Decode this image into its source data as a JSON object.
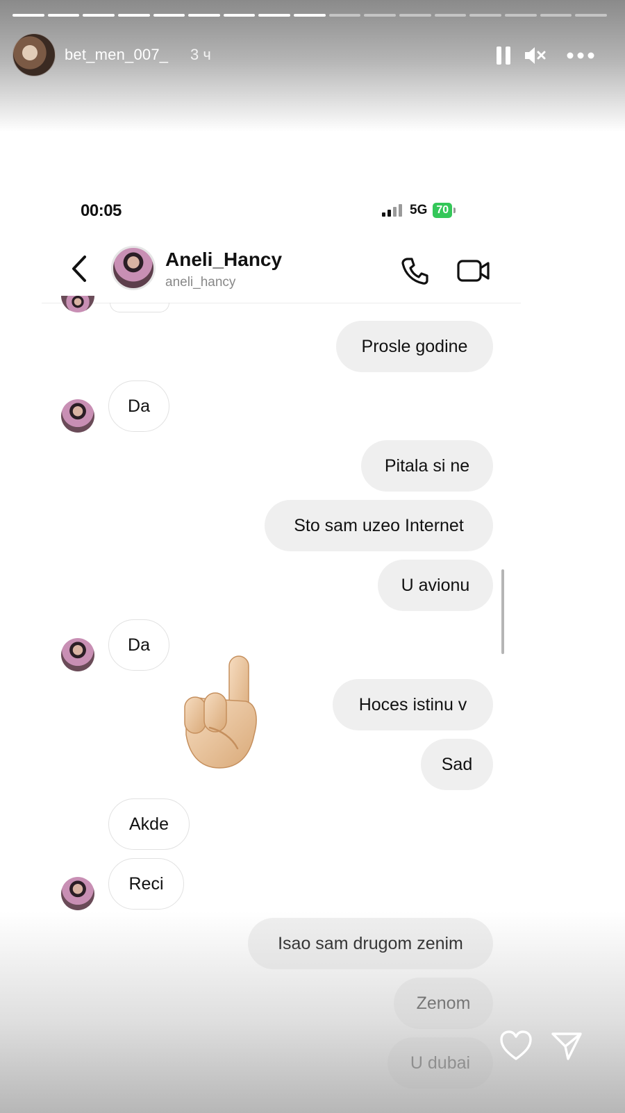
{
  "story": {
    "username": "bet_men_007_",
    "time_ago": "3 ч",
    "progress": {
      "segments_total": 17,
      "segments_viewed": 9
    },
    "icons": {
      "pause": "pause-icon",
      "mute": "mute-icon",
      "more": "more-icon",
      "like": "heart-icon",
      "share": "send-icon"
    }
  },
  "screenshot": {
    "status_bar": {
      "time": "00:05",
      "network": "5G",
      "battery": "70"
    },
    "chat": {
      "contact_name": "Aneli_Hancy",
      "contact_handle": "aneli_hancy",
      "messages": [
        {
          "dir": "out",
          "text": "Prosle godine"
        },
        {
          "dir": "in",
          "text": "Da"
        },
        {
          "dir": "out",
          "text": "Pitala si ne"
        },
        {
          "dir": "out",
          "text": "Sto sam uzeo Internet"
        },
        {
          "dir": "out",
          "text": "U avionu"
        },
        {
          "dir": "in",
          "text": "Da"
        },
        {
          "dir": "out",
          "text": "Hoces istinu v"
        },
        {
          "dir": "out",
          "text": "Sad"
        },
        {
          "dir": "in",
          "text": "Akde"
        },
        {
          "dir": "in",
          "text": "Reci"
        },
        {
          "dir": "out",
          "text": "Isao sam drugom zenim"
        },
        {
          "dir": "out",
          "text": "Zenom"
        },
        {
          "dir": "out",
          "text": "U dubai"
        }
      ]
    }
  },
  "sticker": "pointing-up-hand"
}
